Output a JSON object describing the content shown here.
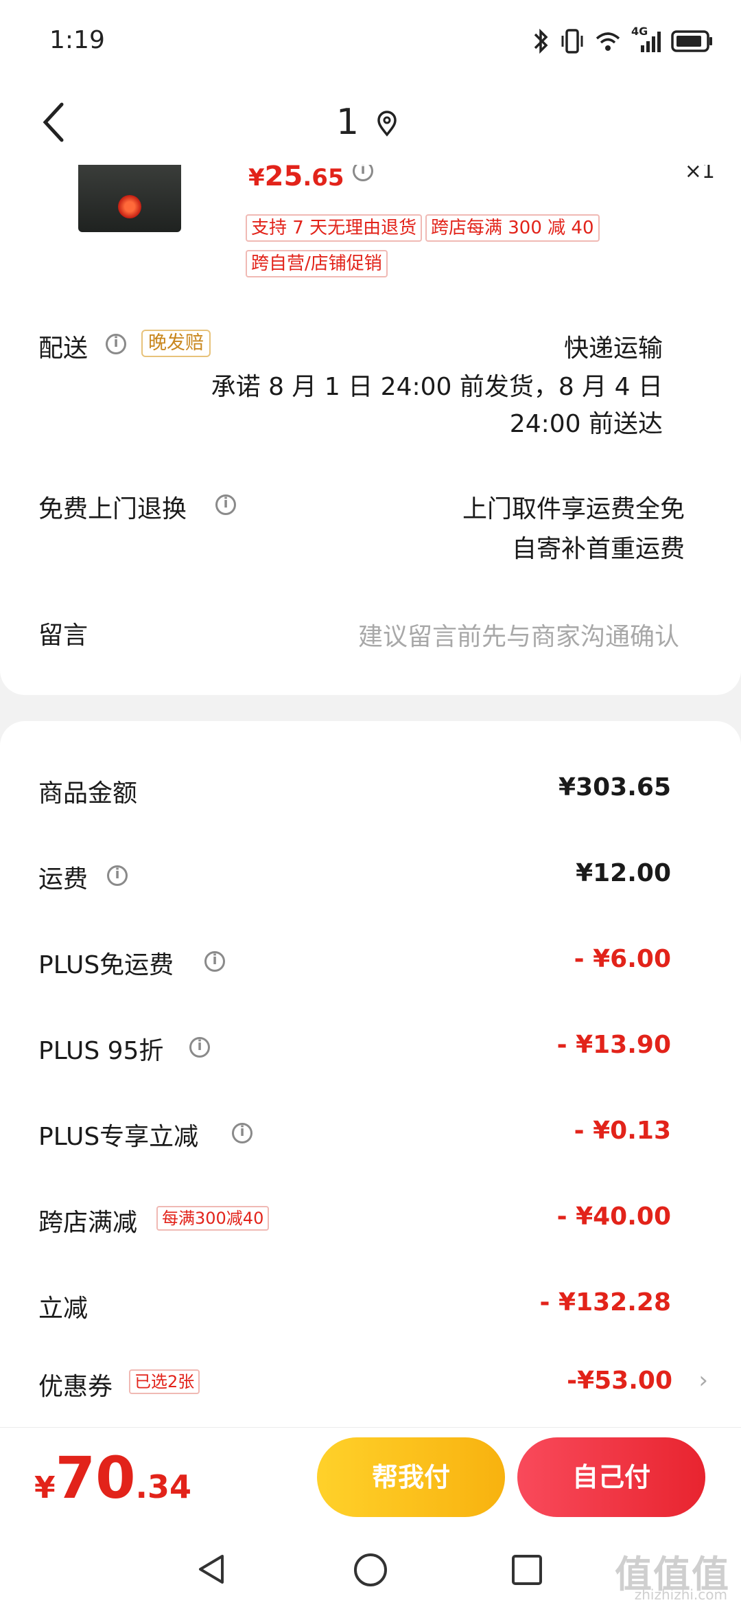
{
  "status_bar": {
    "time": "1:19",
    "network": "4G"
  },
  "header": {
    "title": "1"
  },
  "product": {
    "price_symbol": "¥",
    "price_int": "25",
    "price_dec": ".65",
    "quantity": "×1",
    "tags": [
      "支持 7 天无理由退货",
      "跨店每满 300 减 40",
      "跨自营/店铺促销"
    ]
  },
  "delivery": {
    "label": "配送",
    "badge": "晚发赔",
    "method": "快递运输",
    "promise_line1": "承诺 8 月 1 日 24:00 前发货，8 月 4 日",
    "promise_line2": "24:00 前送达"
  },
  "return_service": {
    "label": "免费上门退换",
    "line1": "上门取件享运费全免",
    "line2": "自寄补首重运费"
  },
  "message": {
    "label": "留言",
    "placeholder": "建议留言前先与商家沟通确认"
  },
  "costs": {
    "goods_label": "商品金额",
    "goods_value": "¥303.65",
    "shipping_label": "运费",
    "shipping_value": "¥12.00",
    "plus_free_ship_label": "PLUS免运费",
    "plus_free_ship_value": "- ¥6.00",
    "plus95_label": "PLUS 95折",
    "plus95_value": "- ¥13.90",
    "plus_exclusive_label": "PLUS专享立减",
    "plus_exclusive_value": "- ¥0.13",
    "cross_store_label": "跨店满减",
    "cross_store_tag": "每满300减40",
    "cross_store_value": "- ¥40.00",
    "instant_label": "立减",
    "instant_value": "- ¥132.28",
    "coupon_label": "优惠券",
    "coupon_tag": "已选2张",
    "coupon_value": "-¥53.00"
  },
  "bottom_bar": {
    "total_symbol": "¥",
    "total_int": "70",
    "total_dec": ".34",
    "help_pay_label": "帮我付",
    "self_pay_label": "自己付"
  },
  "watermark": {
    "text": "值值值",
    "sub": "zhizhizhi.com"
  },
  "colors": {
    "accent_red": "#e2231a",
    "yellow": "#f8b20f",
    "button_red": "#e8242f"
  }
}
